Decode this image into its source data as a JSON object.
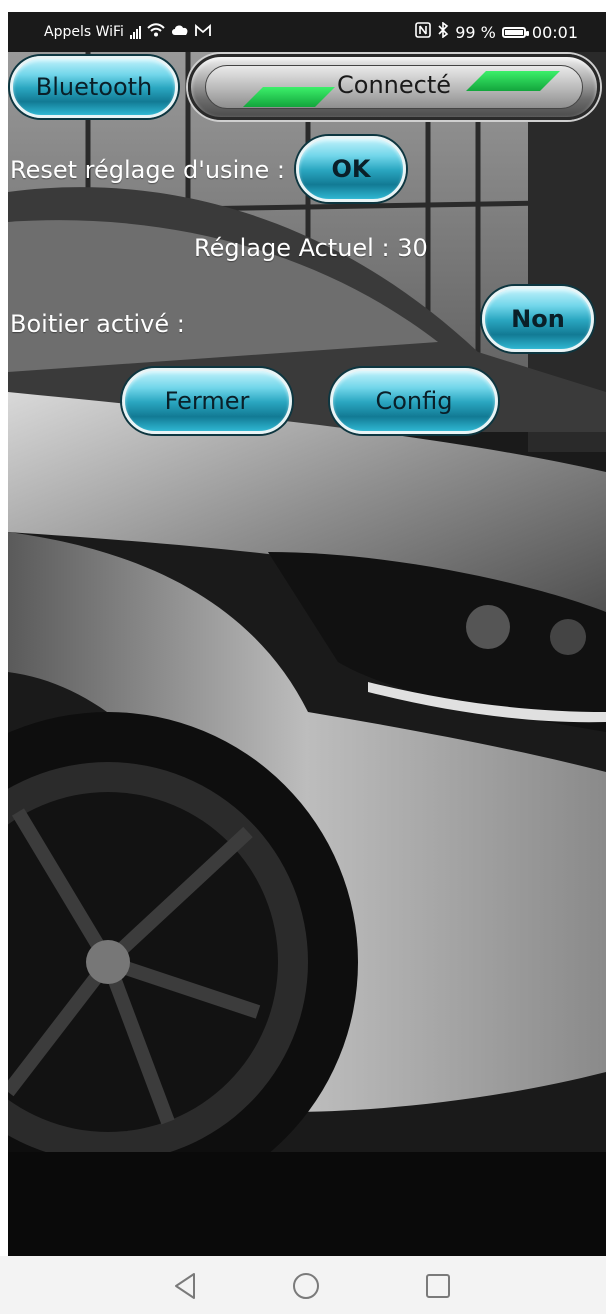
{
  "statusbar": {
    "carrier": "Appels WiFi",
    "battery_text": "99 %",
    "time": "00:01",
    "icons": [
      "signal-icon",
      "wifi-icon",
      "cloud-icon",
      "mail-icon",
      "nfc-icon",
      "bluetooth-icon",
      "battery-icon"
    ]
  },
  "bluetooth_button": "Bluetooth",
  "connection_status": "Connecté",
  "reset_label": "Reset réglage d'usine :",
  "ok_button": "OK",
  "current_setting": "Réglage Actuel : 30",
  "box_active_label": "Boitier activé :",
  "non_button": "Non",
  "close_button": "Fermer",
  "config_button": "Config",
  "background_image": "car-headlight-photo",
  "colors": {
    "pill_accent": "#2aa6c0",
    "status_stripe": "#22c84f",
    "navbar_bg": "#f3f3f3"
  },
  "navbar": {
    "icons": [
      "back-icon",
      "home-icon",
      "recents-icon"
    ]
  }
}
